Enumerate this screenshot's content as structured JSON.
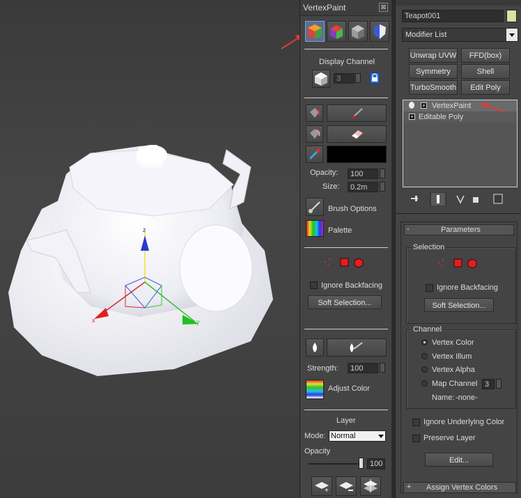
{
  "vertexpaint": {
    "title": "VertexPaint",
    "close_glyph": "⊠",
    "display_channel": {
      "label": "Display Channel",
      "value": "3"
    },
    "opacity": {
      "label": "Opacity:",
      "value": "100"
    },
    "size": {
      "label": "Size:",
      "value": "0.2m"
    },
    "brush_options": "Brush Options",
    "palette": "Palette",
    "ignore_backfacing": "Ignore Backfacing",
    "soft_selection": "Soft Selection...",
    "strength": {
      "label": "Strength:",
      "value": "100"
    },
    "adjust_color": "Adjust Color",
    "layer": {
      "title": "Layer",
      "mode_label": "Mode:",
      "mode_value": "Normal",
      "opacity_label": "Opacity",
      "opacity_value": "100"
    }
  },
  "modifier_panel": {
    "object_name": "Teapot001",
    "object_color": "#d4e6a0",
    "modifier_list": "Modifier List",
    "buttons": [
      "Unwrap UVW",
      "FFD(box)",
      "Symmetry",
      "Shell",
      "TurboSmooth",
      "Edit Poly"
    ],
    "stack": [
      {
        "label": "VertexPaint",
        "selected": true
      },
      {
        "label": "Editable Poly",
        "selected": false
      }
    ],
    "parameters": {
      "title": "Parameters",
      "selection_group": "Selection",
      "ignore_backfacing": "Ignore Backfacing",
      "soft_selection": "Soft Selection...",
      "channel_group": "Channel",
      "channels": [
        {
          "label": "Vertex Color",
          "selected": true
        },
        {
          "label": "Vertex Illum",
          "selected": false
        },
        {
          "label": "Vertex Alpha",
          "selected": false
        },
        {
          "label": "Map Channel",
          "selected": false
        }
      ],
      "map_channel_value": "3",
      "name_label": "Name:",
      "name_value": "-none-",
      "ignore_underlying": "Ignore Underlying Color",
      "preserve_layer": "Preserve Layer",
      "edit_button": "Edit..."
    },
    "assign_rollout": "Assign Vertex Colors",
    "rollout_minus": "-",
    "rollout_plus": "+"
  },
  "colors": {
    "annotation_arrow": "#e03a3a",
    "panel_bg": "#444444",
    "highlight": "#5a8fe0"
  }
}
